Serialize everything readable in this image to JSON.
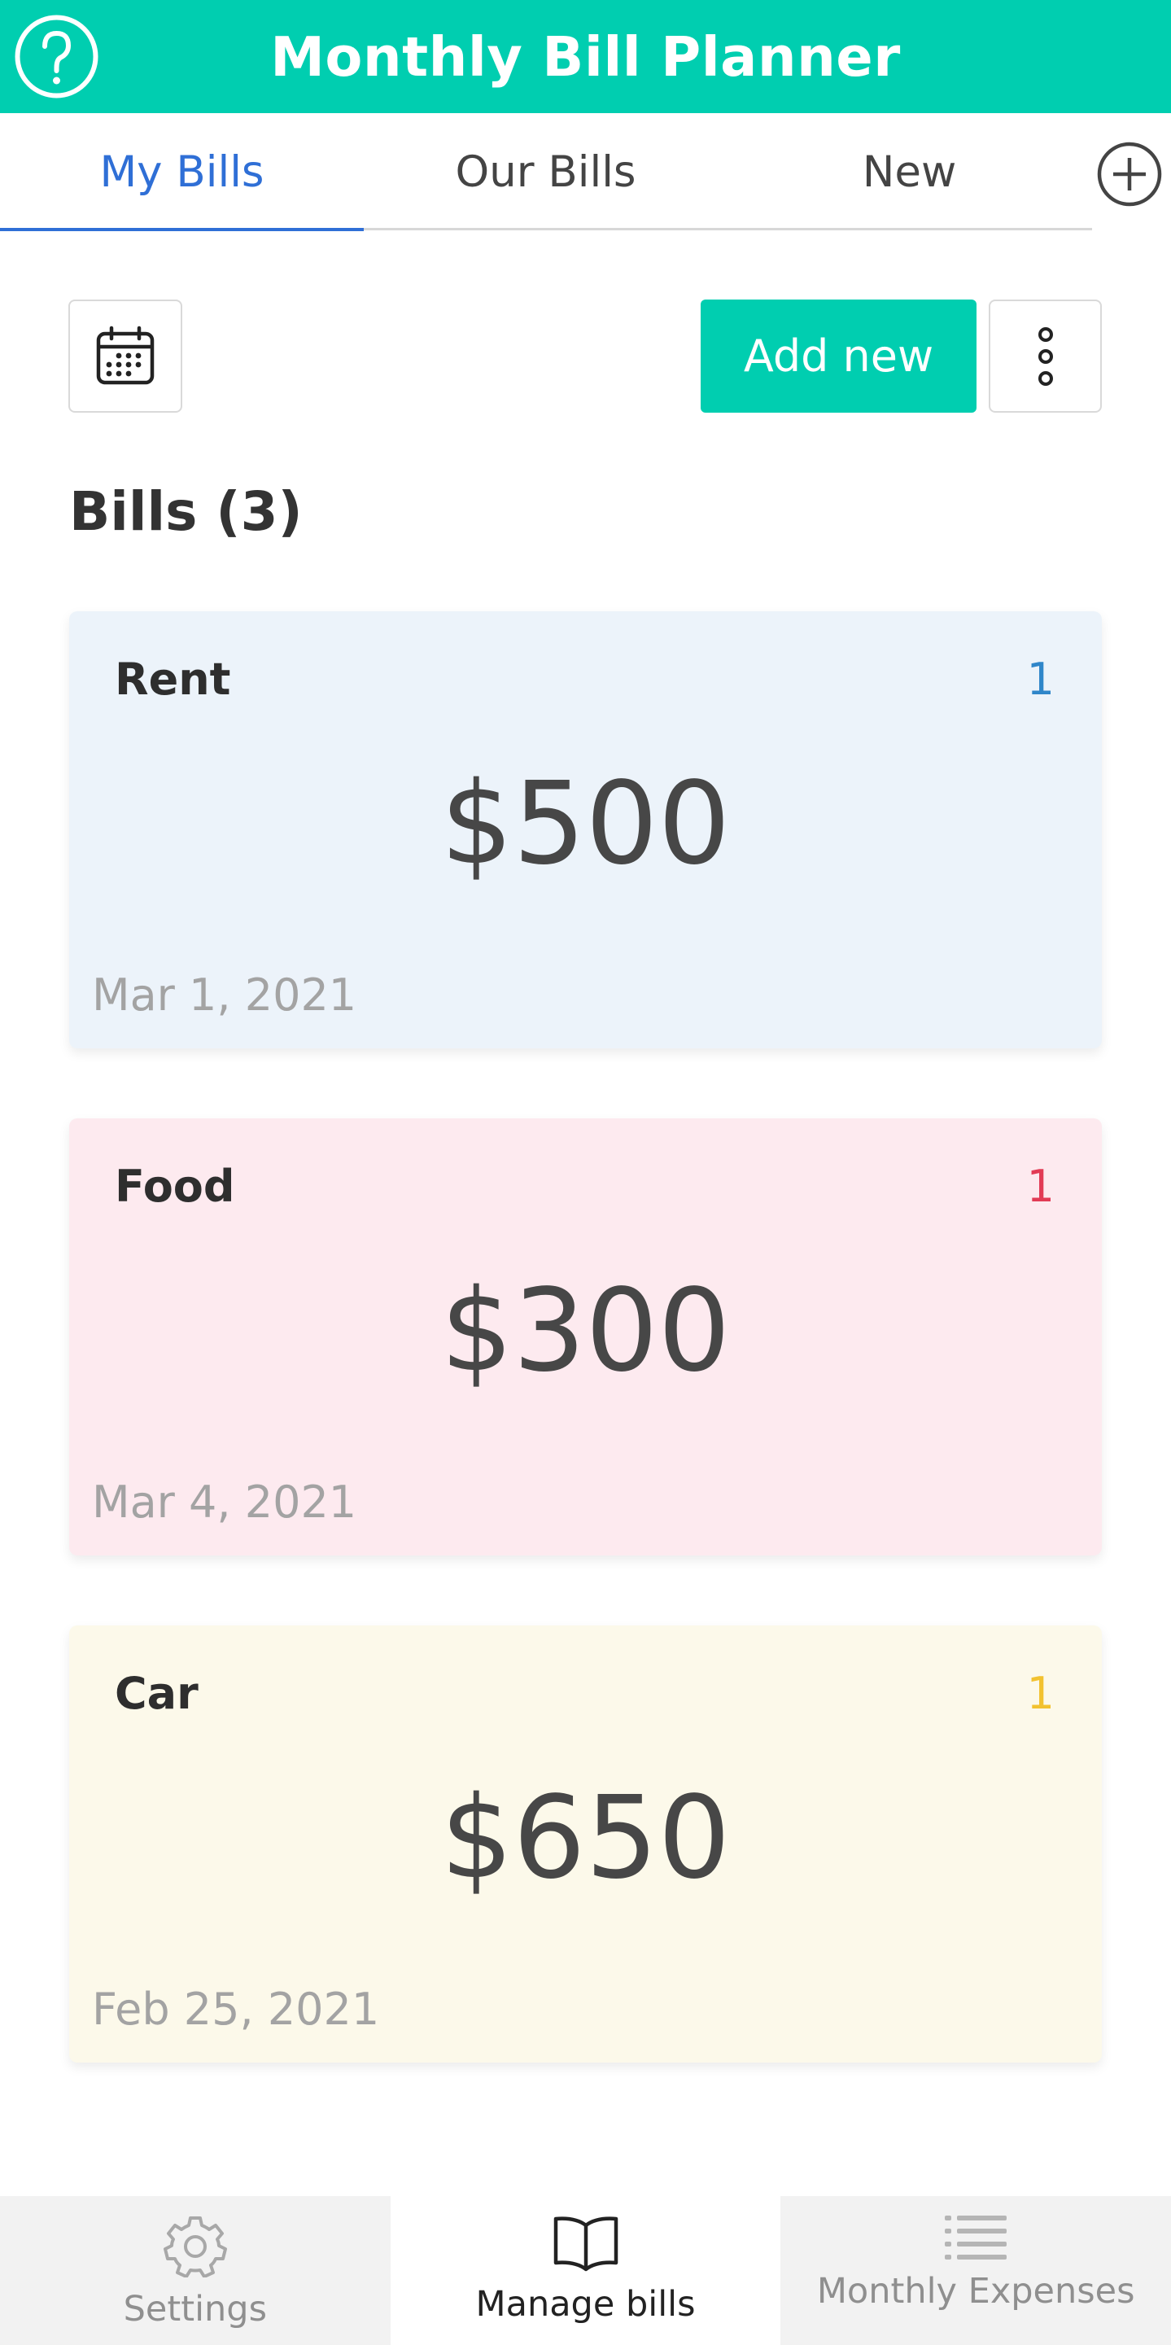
{
  "app": {
    "title": "Monthly Bill Planner",
    "help_icon": "help-circle-icon"
  },
  "tabs": [
    {
      "label": "My Bills",
      "active": true
    },
    {
      "label": "Our Bills",
      "active": false
    },
    {
      "label": "New",
      "active": false
    }
  ],
  "toolbar": {
    "calendar_icon": "calendar-icon",
    "add_new_label": "Add new",
    "more_icon": "vertical-dots-icon"
  },
  "bills_section": {
    "title": "Bills (3)"
  },
  "bills": [
    {
      "name": "Rent",
      "count": "1",
      "amount": "$500",
      "date": "Mar 1, 2021",
      "bg": "#ecf3fa",
      "count_color": "#2f86c9"
    },
    {
      "name": "Food",
      "count": "1",
      "amount": "$300",
      "date": "Mar 4, 2021",
      "bg": "#fdeaef",
      "count_color": "#e23b55"
    },
    {
      "name": "Car",
      "count": "1",
      "amount": "$650",
      "date": "Feb 25, 2021",
      "bg": "#fcf9ea",
      "count_color": "#f2c230"
    }
  ],
  "bottom_nav": [
    {
      "label": "Settings",
      "icon": "gear-icon",
      "active": false
    },
    {
      "label": "Manage bills",
      "icon": "book-icon",
      "active": true
    },
    {
      "label": "Monthly Expenses",
      "icon": "list-icon",
      "active": false
    }
  ],
  "colors": {
    "accent": "#00ceb0",
    "tab_active": "#2f6fd6"
  }
}
